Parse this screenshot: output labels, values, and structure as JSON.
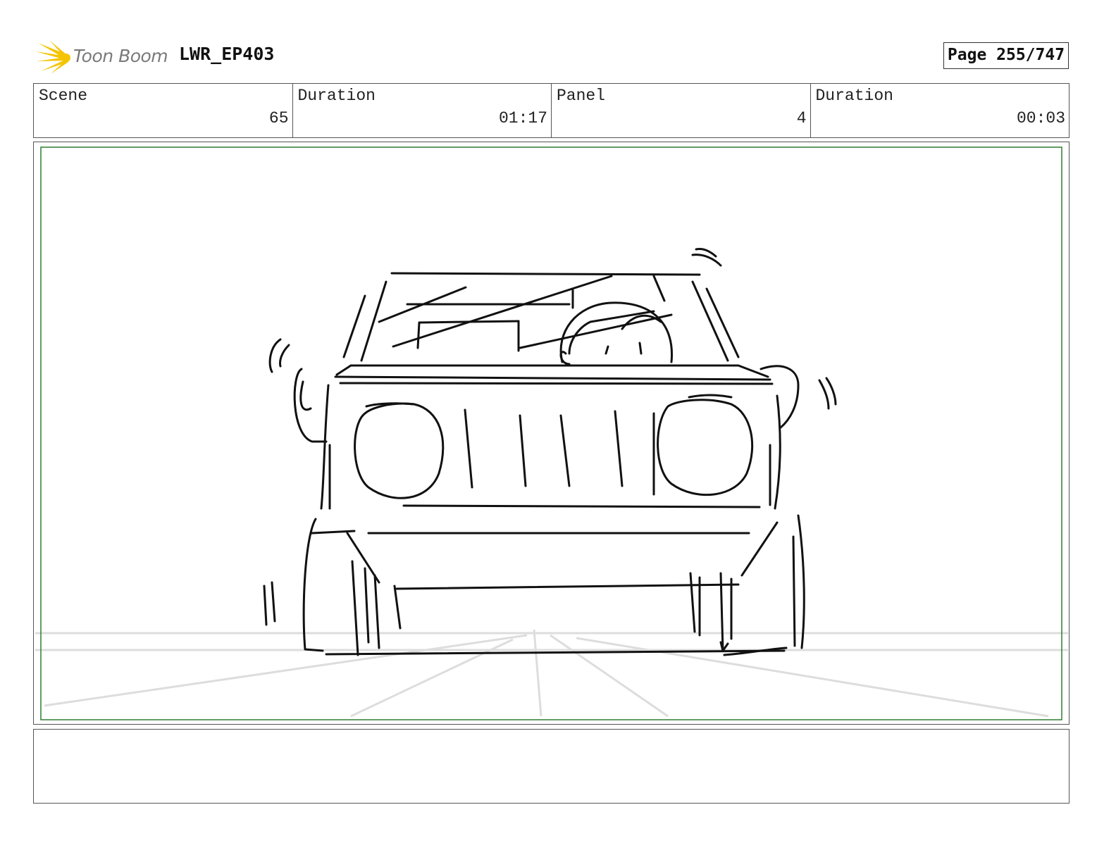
{
  "header": {
    "logo_text": "Toon Boom",
    "project_title": "LWR_EP403",
    "page_indicator": "Page 255/747"
  },
  "info": {
    "scene_label": "Scene",
    "scene_value": "65",
    "scene_duration_label": "Duration",
    "scene_duration_value": "01:17",
    "panel_label": "Panel",
    "panel_value": "4",
    "panel_duration_label": "Duration",
    "panel_duration_value": "00:03"
  },
  "colors": {
    "logo_yellow": "#f5c400",
    "safe_frame": "#2e7d32",
    "sketch_ink": "#111111",
    "guide_lines": "#dddddd"
  },
  "panel": {
    "image": "storyboard-sketch-truck-front-view"
  },
  "notes": {
    "text": ""
  }
}
